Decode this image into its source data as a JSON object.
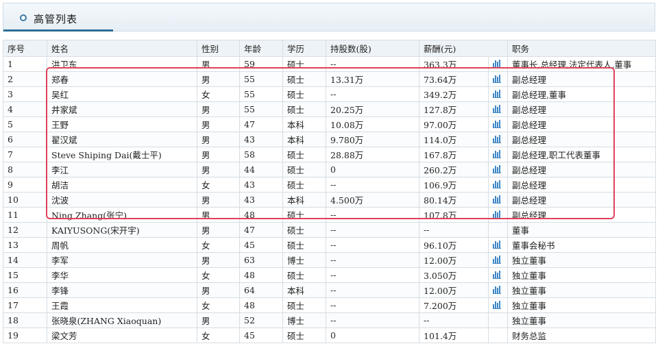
{
  "header": {
    "title": "高管列表"
  },
  "table": {
    "columns": [
      "序号",
      "姓名",
      "性别",
      "年龄",
      "学历",
      "持股数(股)",
      "薪酬(元)",
      "",
      "职务"
    ],
    "rows": [
      {
        "no": "1",
        "name": "洪卫东",
        "gender": "男",
        "age": "59",
        "edu": "硕士",
        "shares": "--",
        "salary": "363.3万",
        "chart": true,
        "position": "董事长,总经理,法定代表人,董事"
      },
      {
        "no": "2",
        "name": "郑春",
        "gender": "男",
        "age": "55",
        "edu": "硕士",
        "shares": "13.31万",
        "salary": "73.64万",
        "chart": true,
        "position": "副总经理"
      },
      {
        "no": "3",
        "name": "吴红",
        "gender": "女",
        "age": "55",
        "edu": "硕士",
        "shares": "--",
        "salary": "349.2万",
        "chart": true,
        "position": "副总经理,董事"
      },
      {
        "no": "4",
        "name": "井家斌",
        "gender": "男",
        "age": "55",
        "edu": "硕士",
        "shares": "20.25万",
        "salary": "127.8万",
        "chart": true,
        "position": "副总经理"
      },
      {
        "no": "5",
        "name": "王野",
        "gender": "男",
        "age": "47",
        "edu": "本科",
        "shares": "10.08万",
        "salary": "97.00万",
        "chart": true,
        "position": "副总经理"
      },
      {
        "no": "6",
        "name": "翟汉斌",
        "gender": "男",
        "age": "43",
        "edu": "本科",
        "shares": "9.780万",
        "salary": "114.0万",
        "chart": true,
        "position": "副总经理"
      },
      {
        "no": "7",
        "name": "Steve Shiping Dai(戴士平)",
        "gender": "男",
        "age": "58",
        "edu": "硕士",
        "shares": "28.88万",
        "salary": "167.8万",
        "chart": true,
        "position": "副总经理,职工代表董事"
      },
      {
        "no": "8",
        "name": "李江",
        "gender": "男",
        "age": "44",
        "edu": "硕士",
        "shares": "0",
        "salary": "260.2万",
        "chart": true,
        "position": "副总经理"
      },
      {
        "no": "9",
        "name": "胡洁",
        "gender": "女",
        "age": "43",
        "edu": "硕士",
        "shares": "--",
        "salary": "106.9万",
        "chart": true,
        "position": "副总经理"
      },
      {
        "no": "10",
        "name": "沈波",
        "gender": "男",
        "age": "43",
        "edu": "本科",
        "shares": "4.500万",
        "salary": "80.14万",
        "chart": true,
        "position": "副总经理"
      },
      {
        "no": "11",
        "name": "Ning Zhang(张宁)",
        "gender": "男",
        "age": "48",
        "edu": "硕士",
        "shares": "--",
        "salary": "107.8万",
        "chart": true,
        "position": "副总经理"
      },
      {
        "no": "12",
        "name": "KAIYUSONG(宋开宇)",
        "gender": "男",
        "age": "47",
        "edu": "硕士",
        "shares": "--",
        "salary": "--",
        "chart": false,
        "position": "董事"
      },
      {
        "no": "13",
        "name": "周帆",
        "gender": "女",
        "age": "45",
        "edu": "硕士",
        "shares": "--",
        "salary": "96.10万",
        "chart": true,
        "position": "董事会秘书"
      },
      {
        "no": "14",
        "name": "李军",
        "gender": "男",
        "age": "63",
        "edu": "博士",
        "shares": "--",
        "salary": "12.00万",
        "chart": true,
        "position": "独立董事"
      },
      {
        "no": "15",
        "name": "李华",
        "gender": "女",
        "age": "48",
        "edu": "硕士",
        "shares": "--",
        "salary": "3.050万",
        "chart": true,
        "position": "独立董事"
      },
      {
        "no": "16",
        "name": "李锋",
        "gender": "男",
        "age": "64",
        "edu": "本科",
        "shares": "--",
        "salary": "12.00万",
        "chart": true,
        "position": "独立董事"
      },
      {
        "no": "17",
        "name": "王霞",
        "gender": "女",
        "age": "48",
        "edu": "硕士",
        "shares": "--",
        "salary": "7.200万",
        "chart": true,
        "position": "独立董事"
      },
      {
        "no": "18",
        "name": "张晓泉(ZHANG Xiaoquan)",
        "gender": "男",
        "age": "52",
        "edu": "博士",
        "shares": "--",
        "salary": "--",
        "chart": false,
        "position": "独立董事"
      },
      {
        "no": "19",
        "name": "梁文芳",
        "gender": "女",
        "age": "45",
        "edu": "硕士",
        "shares": "0",
        "salary": "101.4万",
        "chart": false,
        "position": "财务总监"
      }
    ]
  },
  "colors": {
    "accent": "#2d6f97",
    "highlight": "#e0405a",
    "icon": "#3d86c6"
  }
}
